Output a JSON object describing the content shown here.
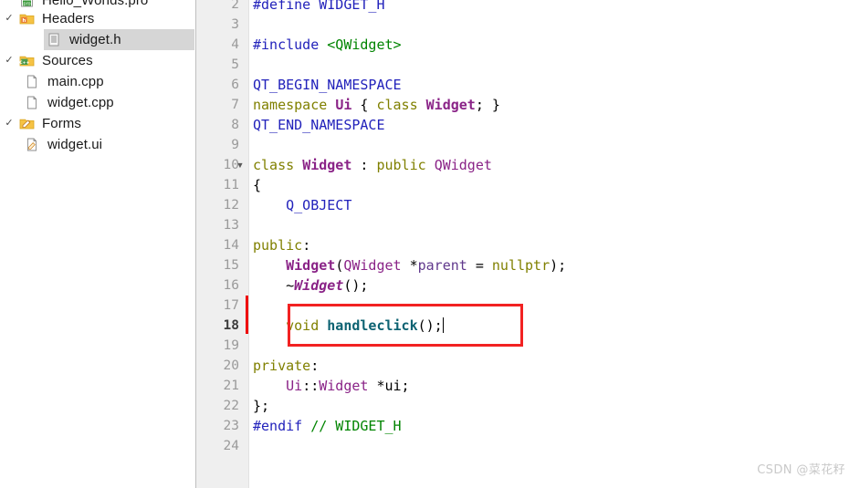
{
  "sidebar": {
    "name": "project-tree",
    "items": [
      {
        "label": "Hello_Worlds.pro",
        "icon": "pro-file-icon",
        "indent": 0,
        "expander": "",
        "selected": false,
        "clipped_top": true
      },
      {
        "label": "Headers",
        "icon": "folder-headers-icon",
        "indent": 0,
        "expander": "✓",
        "selected": false
      },
      {
        "label": "widget.h",
        "icon": "header-file-icon",
        "indent": 1,
        "expander": "",
        "selected": true
      },
      {
        "label": "Sources",
        "icon": "folder-sources-icon",
        "indent": 0,
        "expander": "✓",
        "selected": false
      },
      {
        "label": "main.cpp",
        "icon": "cpp-file-icon",
        "indent": 1,
        "expander": "",
        "selected": false
      },
      {
        "label": "widget.cpp",
        "icon": "cpp-file-icon",
        "indent": 1,
        "expander": "",
        "selected": false
      },
      {
        "label": "Forms",
        "icon": "folder-forms-icon",
        "indent": 0,
        "expander": "✓",
        "selected": false
      },
      {
        "label": "widget.ui",
        "icon": "ui-file-icon",
        "indent": 1,
        "expander": "",
        "selected": false
      }
    ]
  },
  "editor": {
    "current_line": 18,
    "caret_line": 18,
    "fold_marker_line": 10,
    "fold_marker_glyph": "▼",
    "modified_lines": [
      17,
      18
    ],
    "first_visible_line": 2,
    "last_visible_line": 24,
    "lines": [
      {
        "n": 2,
        "text": "#define WIDGET_H"
      },
      {
        "n": 3,
        "text": ""
      },
      {
        "n": 4,
        "text": "#include <QWidget>"
      },
      {
        "n": 5,
        "text": ""
      },
      {
        "n": 6,
        "text": "QT_BEGIN_NAMESPACE"
      },
      {
        "n": 7,
        "text": "namespace Ui { class Widget; }"
      },
      {
        "n": 8,
        "text": "QT_END_NAMESPACE"
      },
      {
        "n": 9,
        "text": ""
      },
      {
        "n": 10,
        "text": "class Widget : public QWidget"
      },
      {
        "n": 11,
        "text": "{"
      },
      {
        "n": 12,
        "text": "    Q_OBJECT"
      },
      {
        "n": 13,
        "text": ""
      },
      {
        "n": 14,
        "text": "public:"
      },
      {
        "n": 15,
        "text": "    Widget(QWidget *parent = nullptr);"
      },
      {
        "n": 16,
        "text": "    ~Widget();"
      },
      {
        "n": 17,
        "text": ""
      },
      {
        "n": 18,
        "text": "    void handleclick();"
      },
      {
        "n": 19,
        "text": ""
      },
      {
        "n": 20,
        "text": "private:"
      },
      {
        "n": 21,
        "text": "    Ui::Widget *ui;"
      },
      {
        "n": 22,
        "text": "};"
      },
      {
        "n": 23,
        "text": "#endif // WIDGET_H"
      },
      {
        "n": 24,
        "text": ""
      }
    ]
  },
  "annotation": {
    "name": "red-highlight-box",
    "targets_line": 18,
    "color": "#f22222"
  },
  "watermark": {
    "text": "CSDN @菜花籽"
  },
  "colors": {
    "preprocessor": "#2222bb",
    "string": "#008400",
    "comment": "#008400",
    "keyword": "#808000",
    "type": "#8a2387",
    "function": "#0c6272",
    "variable": "#60388c",
    "gutter_bg": "#efefef",
    "line_number": "#9a9a9a",
    "selection_bg": "#d6d6d6",
    "modified_marker": "#ee0000",
    "annotation": "#f22222"
  }
}
